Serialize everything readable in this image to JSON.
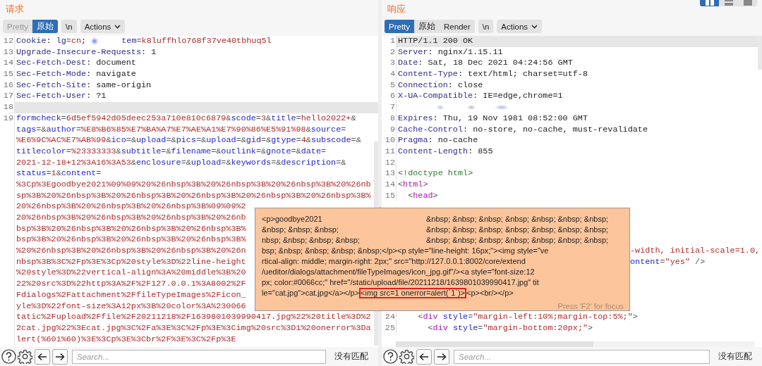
{
  "request": {
    "title": "请求",
    "tabs": [
      {
        "label": "Pretty",
        "selected": false,
        "disabled": true
      },
      {
        "label": "原始",
        "selected": true,
        "disabled": false
      }
    ],
    "newline_button": "\\n",
    "actions_button": "Actions",
    "lines": [
      {
        "number": "12",
        "kind": "segments",
        "current": false,
        "segments": [
          {
            "text": "Cookie",
            "kind": "name"
          },
          {
            "text": ": ",
            "kind": "plain"
          },
          {
            "text": "lg",
            "kind": "name"
          },
          {
            "text": "=",
            "kind": "punct"
          },
          {
            "text": "cn",
            "kind": "value"
          },
          {
            "text": "; ",
            "kind": "plain"
          },
          {
            "kind": "redacted"
          },
          {
            "text": "tem",
            "kind": "name"
          },
          {
            "text": "=",
            "kind": "punct"
          },
          {
            "text": "k8luffhlo768f37ve40tbhuq5l",
            "kind": "value"
          }
        ]
      },
      {
        "number": "13",
        "kind": "header",
        "current": false,
        "text": "Upgrade-Insecure-Requests: 1"
      },
      {
        "number": "14",
        "kind": "header",
        "current": false,
        "text": "Sec-Fetch-Dest: document"
      },
      {
        "number": "15",
        "kind": "header",
        "current": false,
        "text": "Sec-Fetch-Mode: navigate"
      },
      {
        "number": "16",
        "kind": "header",
        "current": false,
        "text": "Sec-Fetch-Site: same-origin"
      },
      {
        "number": "17",
        "kind": "header",
        "current": false,
        "text": "Sec-Fetch-User: ?1"
      },
      {
        "number": "18",
        "kind": "blank",
        "current": true
      },
      {
        "number": "19",
        "kind": "wrapped",
        "current": false,
        "rows": [
          {
            "kind": "params",
            "text": "formcheck=6d5ef5942d05deec253a710e810c6879&scode=3&title=hello2022+&"
          },
          {
            "kind": "params",
            "text": "tags=&author=%E8%B6%85%E7%BA%A7%E7%AE%A1%E7%90%86%E5%91%98&source="
          },
          {
            "kind": "params_cont",
            "text": "%E6%9C%AC%E7%AB%99&ico=&upload=&pics=&upload=&gid=&gtype=4&subscode=&"
          },
          {
            "kind": "params",
            "text": "titlecolor=%23333333&subtitle=&filename=&outlink=&gnote=&date="
          },
          {
            "kind": "params_cont",
            "text": "2021-12-18+12%3A16%3A53&enclosure=&upload=&keywords=&description=&"
          },
          {
            "kind": "params",
            "text": "status=1&content="
          },
          {
            "kind": "value",
            "text": "%3Cp%3Egoodbye2021%09%09%20%26nbsp%3B%20%26nbsp%3B%20%26nbsp%3B%20%26nb"
          },
          {
            "kind": "value",
            "text": "sp%3B%20%26nbsp%3B%20%26nbsp%3B%20%26nbsp%3B%20%26nbsp%3B%20%26nbsp%3B%"
          },
          {
            "kind": "value",
            "text": "20%26nbsp%3B%20%26nbsp%3B%20%26nbsp%3B%09%09%2"
          },
          {
            "kind": "value",
            "text": "20%26nbsp%3B%20%26nbsp%3B%20%26nbsp%3B%20%26nb"
          },
          {
            "kind": "value",
            "text": "bsp%3B%20%26nbsp%3B%20%26nbsp%3B%20%26nbsp%3B%"
          },
          {
            "kind": "value",
            "text": "bsp%3B%20%26nbsp%3B%20%26nbsp%3B%20%26nbsp%3B%"
          },
          {
            "kind": "value",
            "text": "%20%26nbsp%3B%20%26nbsp%3B%20%26nbsp%3B%20%26n"
          },
          {
            "kind": "value",
            "text": "nbsp%3B%3C%2Fp%3E%3Cp%20style%3D%22line-height"
          },
          {
            "kind": "value",
            "text": "%20style%3D%22vertical-align%3A%20middle%3B%20"
          },
          {
            "kind": "value",
            "text": "22%20src%3D%22http%3A%2F%2F127.0.0.1%3A8002%2F"
          },
          {
            "kind": "value",
            "text": "Fdialogs%2Fattachment%2FfileTypeImages%2Ficon_"
          },
          {
            "kind": "value",
            "text": "yle%3D%22font-size%3A12px%3B%20color%3A%230066"
          },
          {
            "kind": "value",
            "text": "tatic%2Fupload%2Ffile%2F20211218%2F1639801039990417.jpg%22%20title%3D%2"
          },
          {
            "kind": "value",
            "text": "2cat.jpg%22%3Ecat.jpg%3C%2Fa%3E%3C%2Fp%3E%3Cimg%20src%3D1%20onerror%3Da"
          },
          {
            "kind": "value",
            "text": "lert(%601%60)%3E%3Cp%3E%3Cbr%2F%3E%3C%2Fp%3E"
          }
        ]
      }
    ],
    "search": {
      "placeholder": "Search..."
    },
    "match_status": "没有匹配"
  },
  "response": {
    "title": "响应",
    "view_toggles": [
      {
        "kind": "split",
        "selected": true
      },
      {
        "kind": "rows",
        "selected": false
      },
      {
        "kind": "single",
        "selected": false
      }
    ],
    "tabs": [
      {
        "label": "Pretty",
        "selected": true,
        "disabled": false
      },
      {
        "label": "原始",
        "selected": false,
        "disabled": false
      },
      {
        "label": "Render",
        "selected": false,
        "disabled": false
      }
    ],
    "newline_button": "\\n",
    "actions_button": "Actions",
    "lines": [
      {
        "number": "1",
        "kind": "plain",
        "current": true,
        "text": "HTTP/1.1 200 OK"
      },
      {
        "number": "2",
        "kind": "header",
        "current": false,
        "text": "Server: nginx/1.15.11"
      },
      {
        "number": "3",
        "kind": "header",
        "current": false,
        "text": "Date: Sat, 18 Dec 2021 04:24:56 GMT"
      },
      {
        "number": "4",
        "kind": "header",
        "current": false,
        "text": "Content-Type: text/html; charset=utf-8"
      },
      {
        "number": "5",
        "kind": "header",
        "current": false,
        "text": "Connection: close"
      },
      {
        "number": "6",
        "kind": "header",
        "current": false,
        "text": "X-UA-Compatible: IE=edge,chrome=1"
      },
      {
        "number": "7",
        "kind": "segments",
        "current": false,
        "segments": [
          {
            "kind": "redacted"
          }
        ]
      },
      {
        "number": "8",
        "kind": "header",
        "current": false,
        "text": "Expires: Thu, 19 Nov 1981 08:52:00 GMT"
      },
      {
        "number": "9",
        "kind": "header",
        "current": false,
        "text": "Cache-Control: no-store, no-cache, must-revalidate"
      },
      {
        "number": "10",
        "kind": "header",
        "current": false,
        "text": "Pragma: no-cache"
      },
      {
        "number": "11",
        "kind": "header",
        "current": false,
        "text": "Content-Length: 855"
      },
      {
        "number": "12",
        "kind": "blank",
        "current": false
      },
      {
        "number": "13",
        "kind": "segments",
        "current": false,
        "segments": [
          {
            "text": "<",
            "kind": "punct"
          },
          {
            "text": "!doctype html",
            "kind": "doctype"
          },
          {
            "text": ">",
            "kind": "punct"
          }
        ]
      },
      {
        "number": "14",
        "kind": "segments",
        "current": false,
        "segments": [
          {
            "text": "<",
            "kind": "punct"
          },
          {
            "text": "html",
            "kind": "tag"
          },
          {
            "text": ">",
            "kind": "punct"
          }
        ]
      },
      {
        "number": "15",
        "kind": "segments",
        "current": false,
        "segments": [
          {
            "text": "  <",
            "kind": "punct"
          },
          {
            "text": "head",
            "kind": "tag"
          },
          {
            "text": ">",
            "kind": "punct"
          }
        ]
      }
    ],
    "covered_fragments": [
      {
        "kind": "segments",
        "segments": [
          {
            "text": "-width, initial-scale=1.0,",
            "kind": "value"
          }
        ]
      },
      {
        "kind": "segments",
        "segments": [
          {
            "text": "ontent",
            "kind": "attr"
          },
          {
            "text": "=",
            "kind": "punct"
          },
          {
            "text": "\"yes\"",
            "kind": "value"
          },
          {
            "text": " />",
            "kind": "punct"
          }
        ]
      }
    ],
    "lines_after": [
      {
        "number": "24",
        "kind": "segments",
        "current": false,
        "segments": [
          {
            "text": "    <",
            "kind": "punct"
          },
          {
            "text": "div",
            "kind": "tag"
          },
          {
            "text": " style",
            "kind": "attr"
          },
          {
            "text": "=",
            "kind": "punct"
          },
          {
            "text": "\"margin-left:10%;margin-top:5%;\"",
            "kind": "value"
          },
          {
            "text": ">",
            "kind": "punct"
          }
        ]
      },
      {
        "number": "25",
        "kind": "segments",
        "current": false,
        "segments": [
          {
            "text": "      <",
            "kind": "punct"
          },
          {
            "text": "div",
            "kind": "tag"
          },
          {
            "text": " style",
            "kind": "attr"
          },
          {
            "text": "=",
            "kind": "punct"
          },
          {
            "text": "\"margin-bottom:20px;\"",
            "kind": "value"
          },
          {
            "text": ">",
            "kind": "punct"
          }
        ]
      }
    ],
    "search": {
      "placeholder": "Search..."
    },
    "match_status": "没有匹配"
  },
  "popup": {
    "lines": [
      {
        "text": "<p>goodbye2021",
        "right": "&nbsp; &nbsp; &nbsp; &nbsp; &nbsp; &nbsp; &nbsp;"
      },
      {
        "text": "&nbsp; &nbsp; &nbsp;",
        "right": "&nbsp; &nbsp; &nbsp; &nbsp; &nbsp; &nbsp; &nbsp;"
      },
      {
        "text": "nbsp; &nbsp; &nbsp; &nbsp;",
        "right": "&nbsp; &nbsp; &nbsp; &nbsp; &nbsp; &nbsp; &nbsp;"
      },
      {
        "text": "bsp; &nbsp; &nbsp; &nbsp; &nbsp;</p><p style=\"line-height: 16px;\"><img style=\"ve"
      },
      {
        "text": "rtical-align: middle; margin-right: 2px;\" src=\"http://127.0.0.1:8002/core/extend"
      },
      {
        "text": "/ueditor/dialogs/attachment/fileTypeImages/icon_jpg.gif\"/><a style=\"font-size:12"
      },
      {
        "text": "px; color:#0066cc;\" href=\"/static/upload/file/20211218/1639801039990417.jpg\" tit"
      },
      {
        "segments": [
          {
            "text": "le=\"cat.jpg\">cat.jpg</a></p>",
            "boxed": false
          },
          {
            "text": "<img src=1 onerror=alert(`1`)>",
            "boxed": true
          },
          {
            "text": "<p><br/></p>",
            "boxed": false
          }
        ]
      }
    ],
    "hint": "Press 'F2' for focus"
  }
}
